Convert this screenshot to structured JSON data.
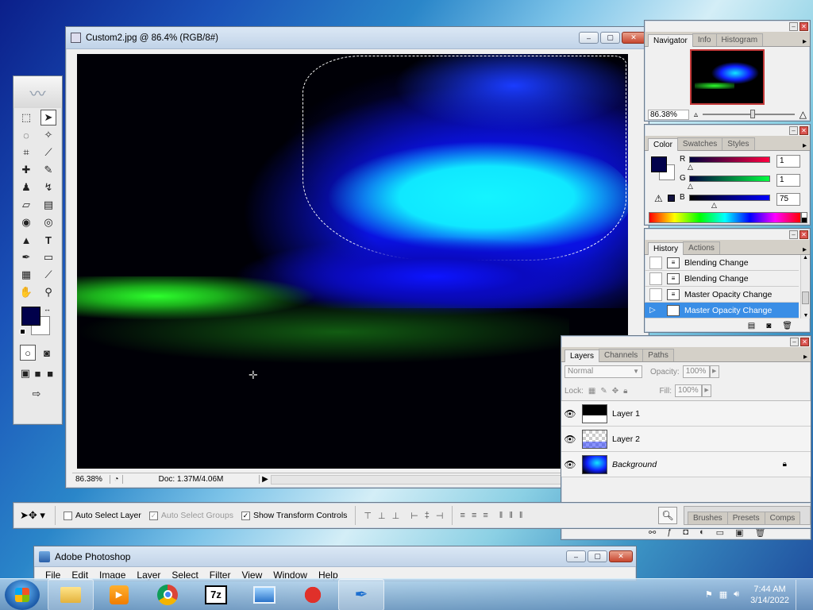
{
  "document": {
    "title": "Custom2.jpg @ 86.4% (RGB/8#)",
    "zoom": "86.38%",
    "doc_info": "Doc: 1.37M/4.06M"
  },
  "navigator": {
    "tabs": [
      "Navigator",
      "Info",
      "Histogram"
    ],
    "zoom": "86.38%"
  },
  "color": {
    "tabs": [
      "Color",
      "Swatches",
      "Styles"
    ],
    "r_label": "R",
    "r_value": "1",
    "g_label": "G",
    "g_value": "1",
    "b_label": "B",
    "b_value": "75",
    "foreground": "#01014b"
  },
  "history": {
    "tabs": [
      "History",
      "Actions"
    ],
    "items": [
      "Blending Change",
      "Blending Change",
      "Master Opacity Change",
      "Master Opacity Change"
    ]
  },
  "layers": {
    "tabs": [
      "Layers",
      "Channels",
      "Paths"
    ],
    "blend_mode": "Normal",
    "opacity_label": "Opacity:",
    "opacity": "100%",
    "lock_label": "Lock:",
    "fill_label": "Fill:",
    "fill": "100%",
    "items": [
      "Layer 1",
      "Layer 2",
      "Background"
    ]
  },
  "options": {
    "auto_select_layer": "Auto Select Layer",
    "auto_select_groups": "Auto Select Groups",
    "show_transform": "Show Transform Controls",
    "wells": [
      "Brushes",
      "Presets",
      "Comps"
    ]
  },
  "app_window": {
    "title": "Adobe Photoshop",
    "menu": [
      "File",
      "Edit",
      "Image",
      "Layer",
      "Select",
      "Filter",
      "View",
      "Window",
      "Help"
    ]
  },
  "taskbar": {
    "time": "7:44 AM",
    "date": "3/14/2022",
    "apps": [
      "file-explorer-icon",
      "media-player-icon",
      "chrome-icon",
      "7zip-icon",
      "image-viewer-icon",
      "paint-app-icon",
      "photoshop-icon"
    ],
    "sevenzip_text": "7z"
  }
}
